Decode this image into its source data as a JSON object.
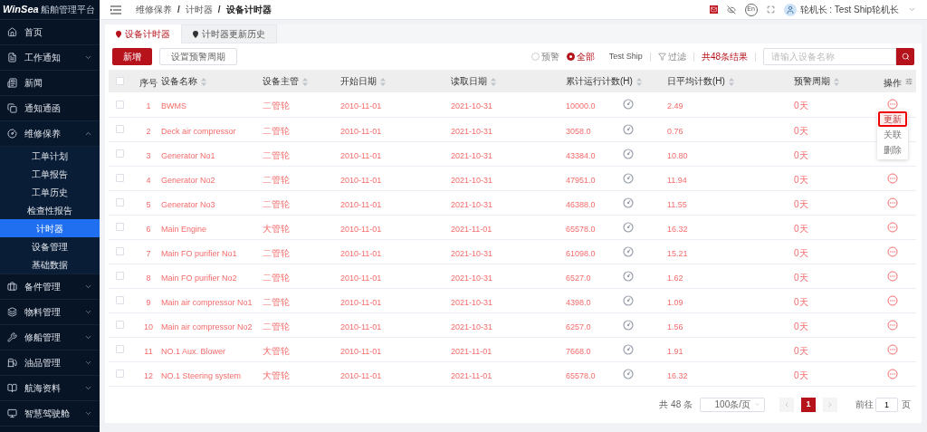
{
  "header": {
    "logo": "WinSea",
    "logo_subtitle": "船舶管理平台",
    "breadcrumb": [
      "维修保养",
      "计时器",
      "设备计时器"
    ],
    "breadcrumb_separators": [
      "/",
      "/"
    ],
    "language": "En",
    "user": "轮机长 : Test Ship轮机长"
  },
  "sidebar": {
    "items": [
      {
        "label": "首页"
      },
      {
        "label": "工作通知",
        "expanded": false
      },
      {
        "label": "新闻"
      },
      {
        "label": "通知通函"
      },
      {
        "label": "维修保养",
        "expanded": true,
        "children": [
          {
            "label": "工单计划",
            "selected": false
          },
          {
            "label": "工单报告",
            "selected": false
          },
          {
            "label": "工单历史",
            "selected": false
          },
          {
            "label": "检查性报告",
            "selected": false
          },
          {
            "label": "计时器",
            "selected": true
          },
          {
            "label": "设备管理",
            "selected": false
          },
          {
            "label": "基础数据",
            "selected": false
          }
        ]
      },
      {
        "label": "备件管理",
        "expanded": false
      },
      {
        "label": "物料管理",
        "expanded": false
      },
      {
        "label": "修船管理",
        "expanded": false
      },
      {
        "label": "油品管理",
        "expanded": false
      },
      {
        "label": "航海资料",
        "expanded": false
      },
      {
        "label": "智慧驾驶舱",
        "expanded": false
      }
    ]
  },
  "tabs": [
    {
      "label": "设备计时器",
      "selected": true
    },
    {
      "label": "计时器更新历史",
      "selected": false
    }
  ],
  "toolbar": {
    "add_button": "新增",
    "warning_button": "设置预警周期",
    "radios": [
      {
        "label": "预警",
        "selected": false
      },
      {
        "label": "全部",
        "selected": true
      }
    ],
    "ship": "Test Ship",
    "filter": "过滤",
    "result_count": "共48条结果",
    "search_placeholder": "请输入设备名称"
  },
  "table": {
    "all_checked": false,
    "columns": [
      "序号",
      "设备名称",
      "设备主管",
      "开始日期",
      "读取日期",
      "累计运行计数(H)",
      "日平均计数(H)",
      "预警周期",
      "操作"
    ],
    "rows": [
      {
        "checked": false,
        "cells": [
          "1",
          "BWMS",
          "二管轮",
          "2010-11-01",
          "2021-10-31",
          "10000.0",
          "2.49",
          "0天"
        ],
        "menu": [
          {
            "label": "更新",
            "selected": true
          },
          {
            "label": "关联",
            "selected": false
          },
          {
            "label": "删除",
            "selected": false
          }
        ]
      },
      {
        "checked": false,
        "cells": [
          "2",
          "Deck air compressor",
          "二管轮",
          "2010-11-01",
          "2021-10-31",
          "3058.0",
          "0.76",
          "0天"
        ]
      },
      {
        "checked": false,
        "cells": [
          "3",
          "Generator No1",
          "二管轮",
          "2010-11-01",
          "2021-10-31",
          "43384.0",
          "10.80",
          "0天"
        ]
      },
      {
        "checked": false,
        "cells": [
          "4",
          "Generator No2",
          "二管轮",
          "2010-11-01",
          "2021-10-31",
          "47951.0",
          "11.94",
          "0天"
        ]
      },
      {
        "checked": false,
        "cells": [
          "5",
          "Generator No3",
          "二管轮",
          "2010-11-01",
          "2021-10-31",
          "46388.0",
          "11.55",
          "0天"
        ]
      },
      {
        "checked": false,
        "cells": [
          "6",
          "Main Engine",
          "大管轮",
          "2010-11-01",
          "2021-11-01",
          "65578.0",
          "16.32",
          "0天"
        ]
      },
      {
        "checked": false,
        "cells": [
          "7",
          "Main FO purifier No1",
          "二管轮",
          "2010-11-01",
          "2021-10-31",
          "61098.0",
          "15.21",
          "0天"
        ]
      },
      {
        "checked": false,
        "cells": [
          "8",
          "Main FO purifier No2",
          "二管轮",
          "2010-11-01",
          "2021-10-31",
          "6527.0",
          "1.62",
          "0天"
        ]
      },
      {
        "checked": false,
        "cells": [
          "9",
          "Main air compressor No1",
          "二管轮",
          "2010-11-01",
          "2021-10-31",
          "4398.0",
          "1.09",
          "0天"
        ]
      },
      {
        "checked": false,
        "cells": [
          "10",
          "Main air compressor No2",
          "二管轮",
          "2010-11-01",
          "2021-10-31",
          "6257.0",
          "1.56",
          "0天"
        ]
      },
      {
        "checked": false,
        "cells": [
          "11",
          "NO.1 Aux. Blower",
          "大管轮",
          "2010-11-01",
          "2021-11-01",
          "7668.0",
          "1.91",
          "0天"
        ]
      },
      {
        "checked": false,
        "cells": [
          "12",
          "NO.1 Steering system",
          "大管轮",
          "2010-11-01",
          "2021-11-01",
          "65578.0",
          "16.32",
          "0天"
        ]
      }
    ]
  },
  "pagination": {
    "total": "共 48 条",
    "page_size": "100条/页",
    "pages": [
      {
        "label": "1",
        "selected": true
      }
    ],
    "goto_label": "前往",
    "goto_value": "1",
    "page_unit": "页"
  }
}
